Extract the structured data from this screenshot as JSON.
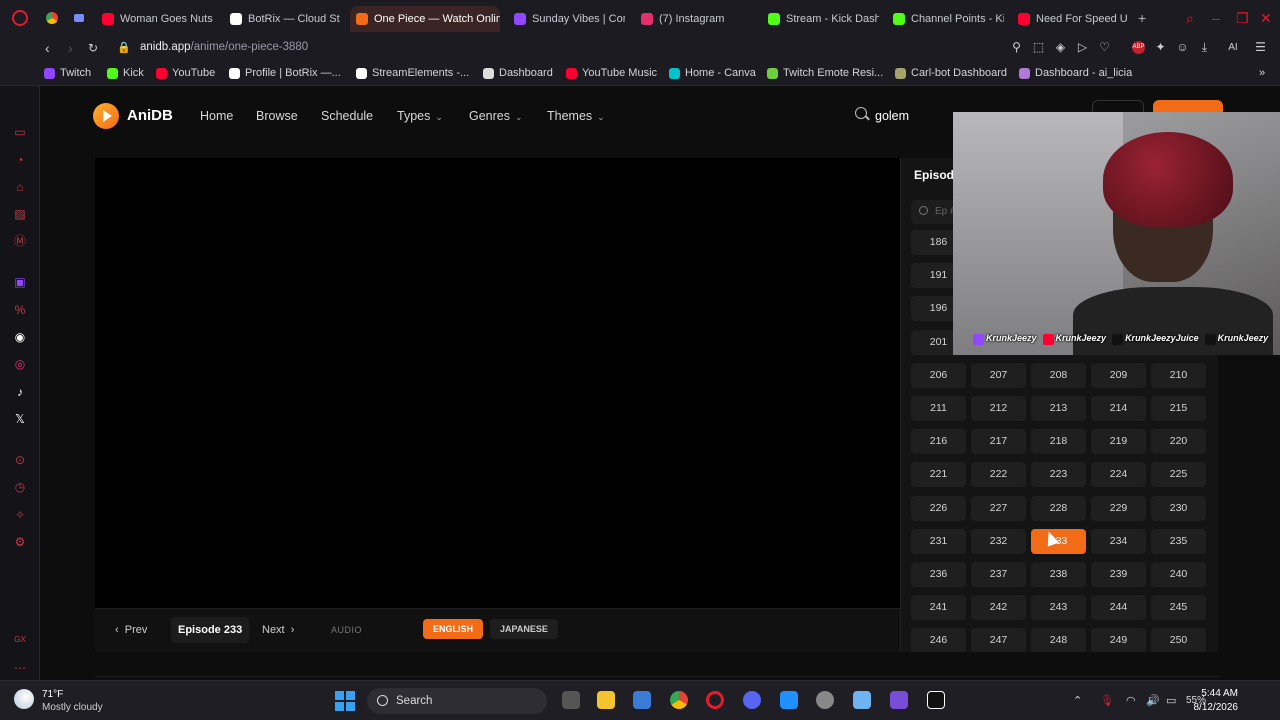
{
  "tabs": [
    {
      "label": "",
      "color": "#7b8cff"
    },
    {
      "label": "Woman Goes Nuts A",
      "color": "#ff0033"
    },
    {
      "label": "BotRix — Cloud Stre",
      "color": "#ffffff"
    },
    {
      "label": "One Piece — Watch Online",
      "color": "#f26b16"
    },
    {
      "label": "Sunday Vibes | Con",
      "color": "#9146ff"
    },
    {
      "label": "(7) Instagram",
      "color": "#e1306c"
    },
    {
      "label": "Stream - Kick Dash",
      "color": "#53fc18"
    },
    {
      "label": "Channel Points - Ki",
      "color": "#53fc18"
    },
    {
      "label": "Need For Speed Un",
      "color": "#ff0033"
    }
  ],
  "address": {
    "host": "anidb.app",
    "path": "/anime/one-piece-3880"
  },
  "extensions": {
    "ai_label": "AI"
  },
  "bookmarks": [
    {
      "label": "Twitch",
      "color": "#9146ff"
    },
    {
      "label": "Kick",
      "color": "#53fc18"
    },
    {
      "label": "YouTube",
      "color": "#ff0033"
    },
    {
      "label": "Profile | BotRix —...",
      "color": "#ffffff"
    },
    {
      "label": "StreamElements -...",
      "color": "#ffffff"
    },
    {
      "label": "Dashboard",
      "color": "#dddddd"
    },
    {
      "label": "YouTube Music",
      "color": "#ff0033"
    },
    {
      "label": "Home - Canva",
      "color": "#00c4cc"
    },
    {
      "label": "Twitch Emote Resi...",
      "color": "#6fcf3a"
    },
    {
      "label": "Carl-bot Dashboard",
      "color": "#a4a46a"
    },
    {
      "label": "Dashboard - ai_licia",
      "color": "#b07ad8"
    }
  ],
  "site": {
    "brand": "AniDB",
    "nav": [
      {
        "label": "Home",
        "dropdown": false
      },
      {
        "label": "Browse",
        "dropdown": false
      },
      {
        "label": "Schedule",
        "dropdown": false
      },
      {
        "label": "Types",
        "dropdown": true
      },
      {
        "label": "Genres",
        "dropdown": true
      },
      {
        "label": "Themes",
        "dropdown": true
      }
    ],
    "search_value": "golem"
  },
  "player": {
    "prev_label": "Prev",
    "episode_label": "Episode 233",
    "next_label": "Next",
    "audio_label": "AUDIO",
    "audio_options": [
      "ENGLISH",
      "JAPANESE"
    ],
    "audio_selected": "ENGLISH"
  },
  "episodes_panel": {
    "title": "Episode",
    "search_placeholder": "Ep #",
    "current": 233,
    "first_visible": [
      186,
      191,
      196,
      201
    ],
    "rows_start": 206,
    "rows_end": 250
  },
  "webcam": {
    "socials": [
      {
        "platform": "twitch",
        "handle": "KrunkJeezy",
        "color": "#9146ff"
      },
      {
        "platform": "youtube",
        "handle": "KrunkJeezy",
        "color": "#ff0033"
      },
      {
        "platform": "tiktok",
        "handle": "KrunkJeezyJuice",
        "color": "#111111"
      },
      {
        "platform": "x",
        "handle": "KrunkJeezy",
        "color": "#111111"
      }
    ]
  },
  "taskbar": {
    "weather_temp": "71°F",
    "weather_desc": "Mostly cloudy",
    "search_label": "Search",
    "battery": "55%",
    "time": "5:44 AM",
    "date": "8/12/2026"
  }
}
